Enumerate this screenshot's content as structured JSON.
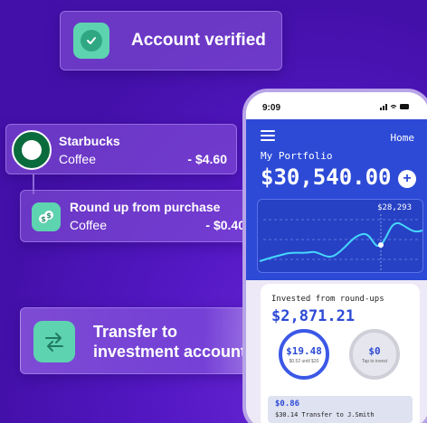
{
  "notifications": {
    "verified": {
      "text": "Account verified",
      "icon": "check-icon"
    },
    "purchase": {
      "merchant": "Starbucks",
      "category": "Coffee",
      "amount": "- $4.60"
    },
    "roundup": {
      "title": "Round up from purchase",
      "category": "Coffee",
      "amount": "- $0.40",
      "icon": "dollar-exchange-icon"
    },
    "transfer": {
      "line1": "Transfer to",
      "line2": "investment account",
      "icon": "transfer-arrows-icon"
    }
  },
  "phone": {
    "status": {
      "time": "9:09",
      "icons": "signal wifi battery"
    },
    "header": {
      "home_label": "Home",
      "portfolio_label": "My Portfolio",
      "portfolio_value": "$30,540.00",
      "peak_label": "$28,293"
    },
    "roundups": {
      "label": "Invested from round-ups",
      "total": "$2,871.21",
      "ring_left": {
        "value": "$19.48",
        "caption": "$0.52 until $20"
      },
      "ring_right": {
        "value": "$0",
        "caption": "Tap to invest"
      },
      "transaction": {
        "amount": "$0.86",
        "description": "$30.14  Transfer to J.Smith"
      }
    }
  },
  "colors": {
    "background": "#4a10b4",
    "accent_teal": "#5ed3b0",
    "phone_blue": "#2d4ad6"
  }
}
